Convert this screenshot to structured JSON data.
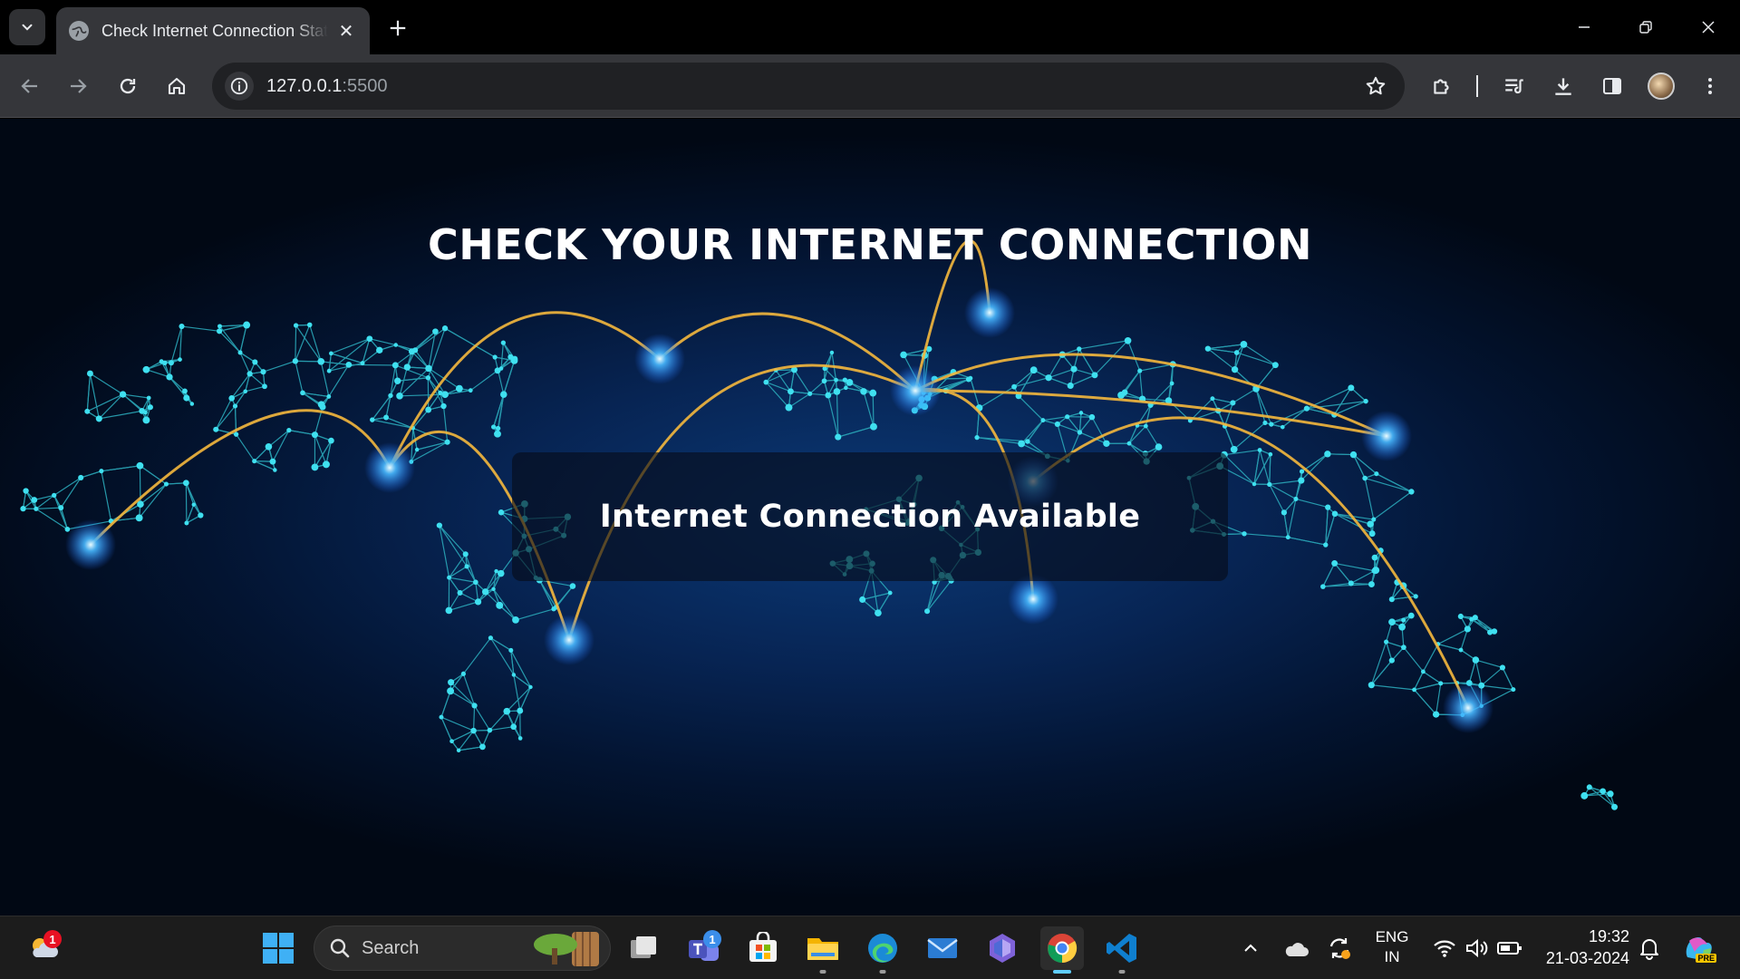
{
  "browser": {
    "tab": {
      "title": "Check Internet Connection Status"
    },
    "url": {
      "host": "127.0.0.1",
      "port": ":5500"
    }
  },
  "page": {
    "heading": "CHECK YOUR INTERNET CONNECTION",
    "status_message": "Internet Connection Available"
  },
  "taskbar": {
    "search_label": "Search",
    "weather_badge": "1",
    "teams_badge": "1",
    "language": {
      "line1": "ENG",
      "line2": "IN"
    },
    "clock": {
      "time": "19:32",
      "date": "21-03-2024"
    },
    "copilot_badge": "PRE"
  },
  "colors": {
    "accent": "#60cdff",
    "arc": "#f5b83d",
    "node": "#3fe0f0",
    "glow": "#48b8ff"
  }
}
